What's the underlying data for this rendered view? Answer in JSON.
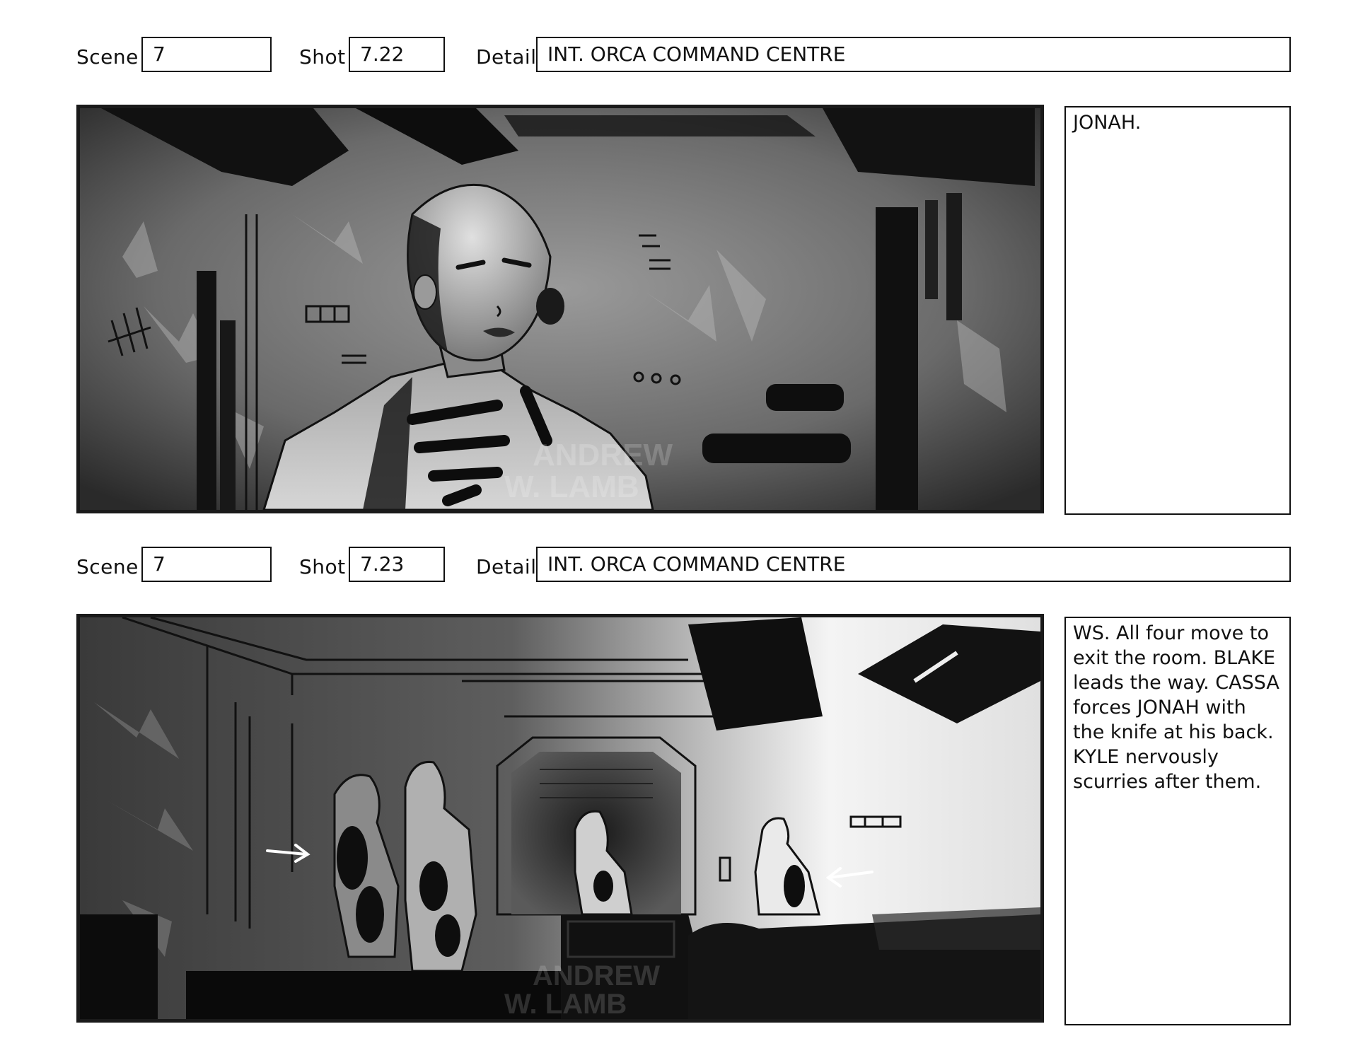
{
  "panels": [
    {
      "scene_label": "Scene",
      "scene_value": "7",
      "shot_label": "Shot",
      "shot_value": "7.22",
      "detail_label": "Detail",
      "detail_value": "INT. ORCA COMMAND CENTRE",
      "notes": "JONAH.",
      "watermark": [
        "ANDREW",
        "W. LAMB"
      ]
    },
    {
      "scene_label": "Scene",
      "scene_value": "7",
      "shot_label": "Shot",
      "shot_value": "7.23",
      "detail_label": "Detail",
      "detail_value": "INT. ORCA COMMAND CENTRE",
      "notes": "WS. All four move to exit the room. BLAKE leads the way. CASSA forces JONAH with the knife at his back. KYLE nervously scurries after them.",
      "watermark": [
        "ANDREW",
        "W. LAMB"
      ]
    }
  ]
}
